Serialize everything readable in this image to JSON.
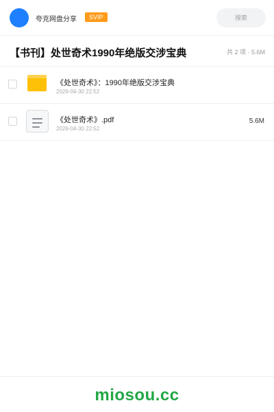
{
  "header": {
    "user_name": "夸克网盘分享",
    "vip_label": "SVIP",
    "search_label": "搜索",
    "accent_color": "#1e80ff"
  },
  "share": {
    "title": "【书刊】处世奇术1990年绝版交涉宝典",
    "summary": "共 2 项 · 5.6M"
  },
  "files": [
    {
      "name": "《处世奇术》：1990年绝版交涉宝典",
      "date": "2026-04-30 22:52",
      "size": "",
      "icon": "folder-icon"
    },
    {
      "name": "《处世奇术》.pdf",
      "date": "2026-04-30 22:52",
      "size": "5.6M",
      "icon": "document-icon"
    }
  ],
  "footer": {
    "logo_text": "miosou.cc",
    "logo_color": "#22a746"
  }
}
